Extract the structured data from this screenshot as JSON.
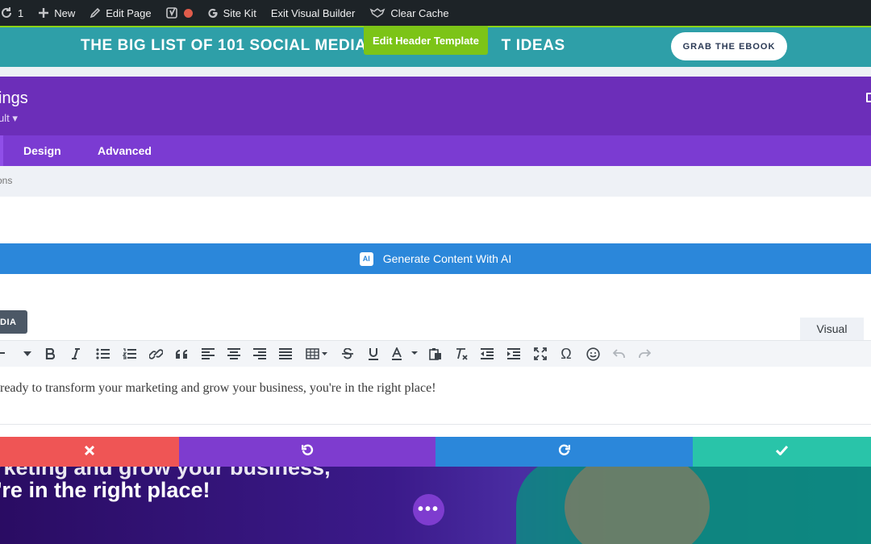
{
  "admin_bar": {
    "updates_count": "1",
    "new_label": "New",
    "edit_page_label": "Edit Page",
    "site_kit_label": "Site Kit",
    "exit_builder_label": "Exit Visual Builder",
    "clear_cache_label": "Clear Cache"
  },
  "site_header": {
    "promo_text": "THE BIG LIST OF 101 SOCIAL MEDIA",
    "promo_text_tail": "T IDEAS",
    "edit_header_label": "Edit Header Template",
    "cta_label": "GRAB THE EBOOK"
  },
  "modal": {
    "title_partial": "ings",
    "preset_partial": "ult ▾",
    "tabs": [
      {
        "label": "Design"
      },
      {
        "label": "Advanced"
      }
    ],
    "search_placeholder": "ons",
    "ai_button_label": "Generate Content With AI",
    "ai_badge": "AI",
    "media_button_partial": "DIA",
    "visual_tab_label": "Visual",
    "editor_text": "ready to transform your marketing and grow your business, you're in the right place!"
  },
  "hero": {
    "line1_partial": "rketing and grow your business,",
    "line2_partial": "'re in the right place!",
    "more_label": "•••"
  },
  "colors": {
    "admin_bar": "#1d2327",
    "header_teal": "#2e9fa8",
    "edit_template_green": "#7cc417",
    "modal_purple": "#6c2eb9",
    "tabs_purple": "#7b3bd2",
    "ai_blue": "#2b87da",
    "cancel_red": "#ef5555",
    "undo_purple": "#7e3ccf",
    "redo_blue": "#2b87da",
    "save_green": "#29c4a9"
  },
  "icons": [
    "updates-icon",
    "plus-icon",
    "pencil-icon",
    "yoast-icon",
    "status-dot-icon",
    "google-icon",
    "cache-icon",
    "close-icon",
    "undo-icon",
    "redo-icon",
    "check-icon"
  ]
}
